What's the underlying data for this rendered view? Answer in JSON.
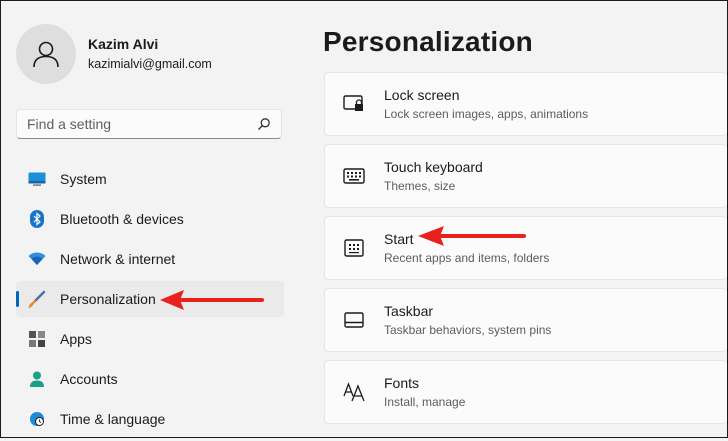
{
  "user": {
    "name": "Kazim Alvi",
    "email": "kazimialvi@gmail.com"
  },
  "search": {
    "placeholder": "Find a setting"
  },
  "sidebar": {
    "items": [
      {
        "label": "System",
        "icon": "monitor-icon",
        "selected": false
      },
      {
        "label": "Bluetooth & devices",
        "icon": "bluetooth-icon",
        "selected": false
      },
      {
        "label": "Network & internet",
        "icon": "wifi-icon",
        "selected": false
      },
      {
        "label": "Personalization",
        "icon": "paintbrush-icon",
        "selected": true
      },
      {
        "label": "Apps",
        "icon": "apps-icon",
        "selected": false
      },
      {
        "label": "Accounts",
        "icon": "person-icon",
        "selected": false
      },
      {
        "label": "Time & language",
        "icon": "globe-clock-icon",
        "selected": false
      }
    ]
  },
  "main": {
    "title": "Personalization",
    "cards": [
      {
        "title": "Lock screen",
        "subtitle": "Lock screen images, apps, animations",
        "icon": "lock-screen-icon"
      },
      {
        "title": "Touch keyboard",
        "subtitle": "Themes, size",
        "icon": "keyboard-icon"
      },
      {
        "title": "Start",
        "subtitle": "Recent apps and items, folders",
        "icon": "start-menu-icon"
      },
      {
        "title": "Taskbar",
        "subtitle": "Taskbar behaviors, system pins",
        "icon": "taskbar-icon"
      },
      {
        "title": "Fonts",
        "subtitle": "Install, manage",
        "icon": "fonts-icon"
      }
    ]
  },
  "colors": {
    "accent": "#0067c0",
    "annotation_arrow": "#e8211d",
    "background": "#f3f3f3"
  }
}
